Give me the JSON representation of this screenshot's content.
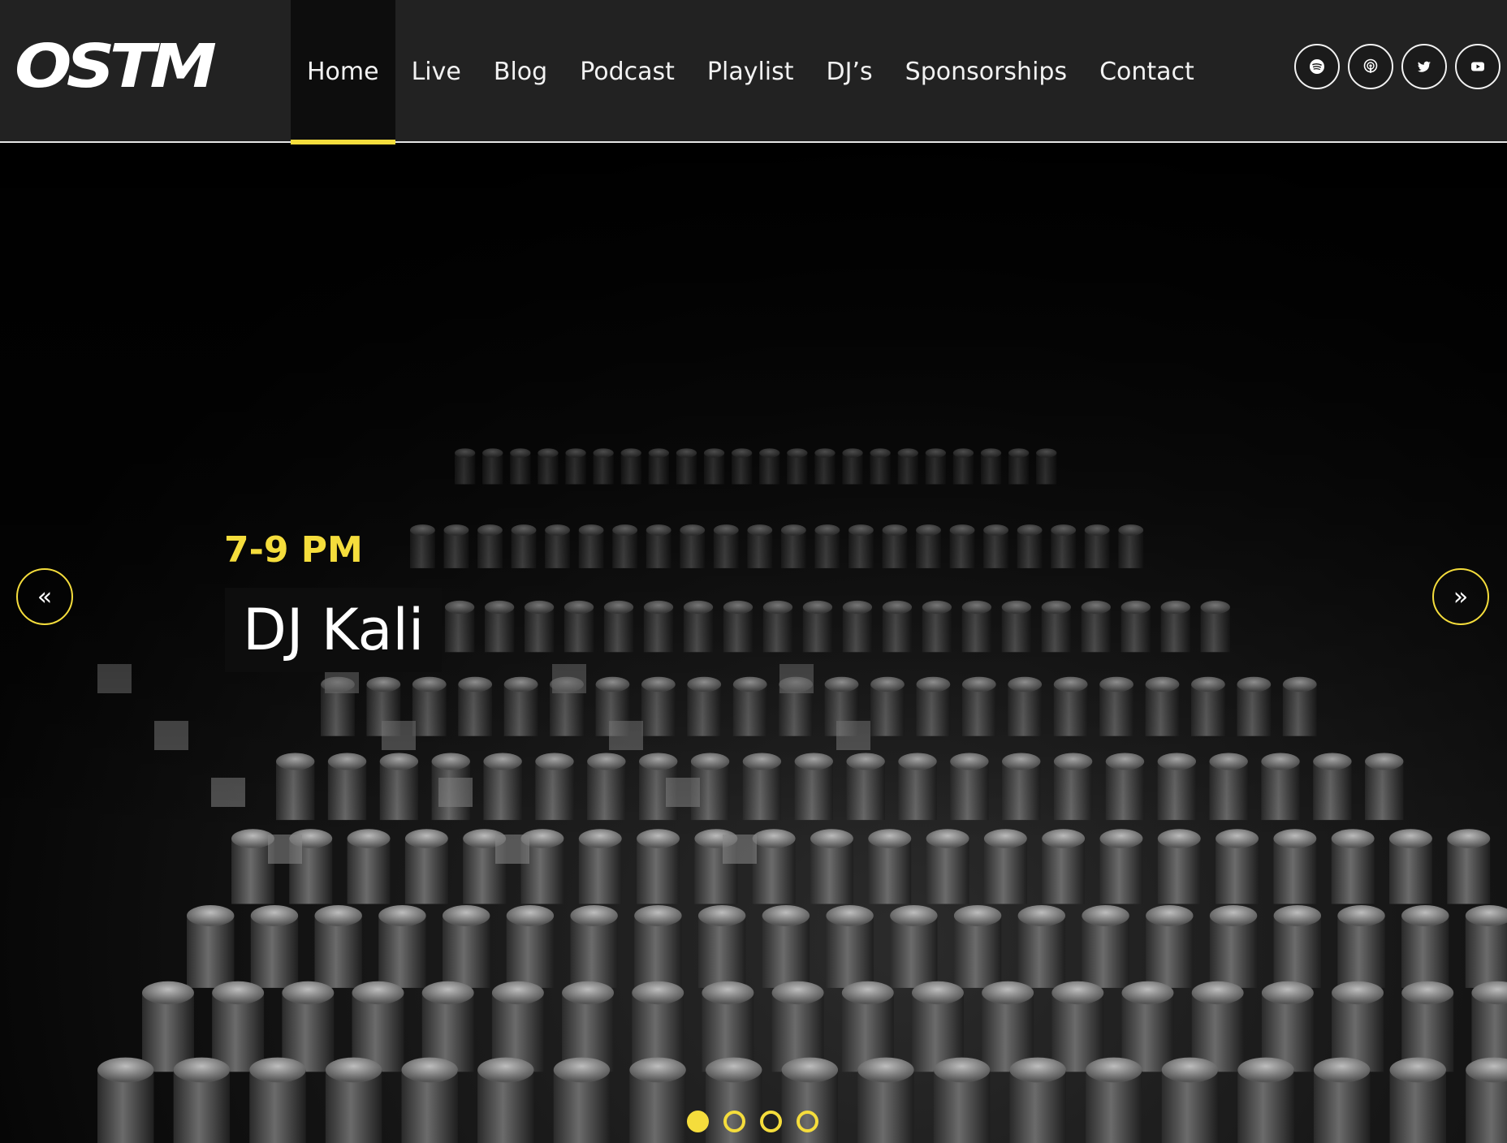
{
  "header": {
    "logo_text": "OSTM",
    "nav": [
      {
        "label": "Home",
        "active": true
      },
      {
        "label": "Live"
      },
      {
        "label": "Blog"
      },
      {
        "label": "Podcast"
      },
      {
        "label": "Playlist"
      },
      {
        "label": "DJ’s"
      },
      {
        "label": "Sponsorships"
      },
      {
        "label": "Contact"
      }
    ],
    "social": [
      "spotify-icon",
      "podcast-icon",
      "twitter-icon",
      "youtube-icon"
    ]
  },
  "hero": {
    "slide_time": "7-9 PM",
    "slide_title": "DJ Kali",
    "prev_label": "«",
    "next_label": "»",
    "slide_count": 4,
    "active_slide": 1
  },
  "colors": {
    "accent": "#f5dd3c",
    "header_bg": "#222222",
    "active_nav_bg": "#0d0d0d"
  }
}
